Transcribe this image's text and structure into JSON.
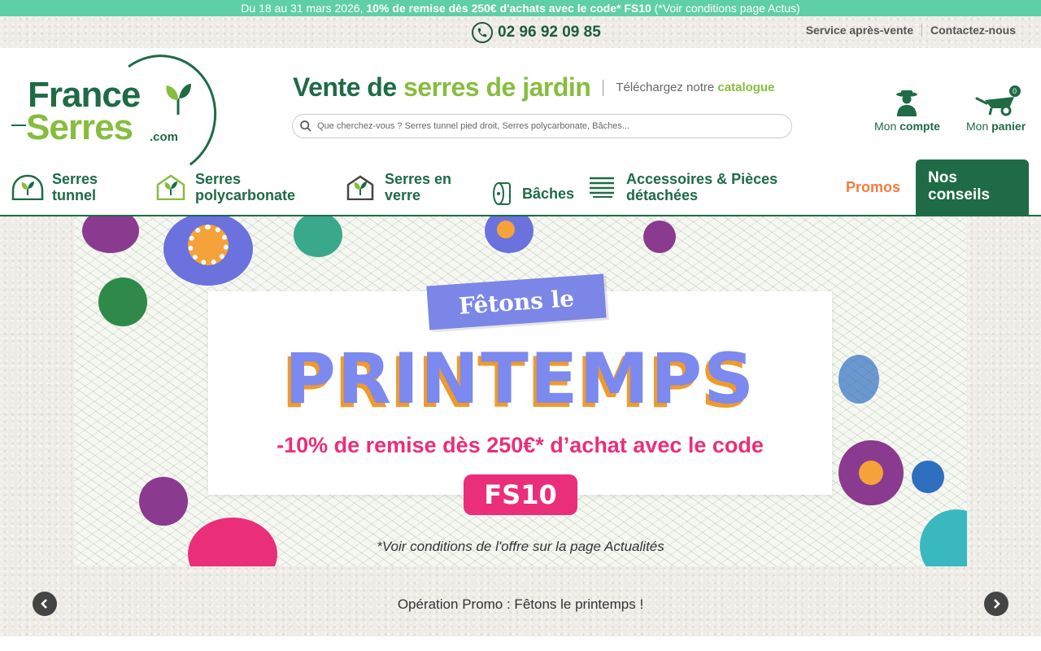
{
  "promo_bar": {
    "prefix": "Du 18 au 31 mars 2026, ",
    "bold": "10% de remise dès 250€ d'achats avec le code* FS10",
    "suffix": " (*Voir conditions page Actus)"
  },
  "utility": {
    "phone": "02 96 92 09 85",
    "links": [
      "Service après-vente",
      "Contactez-nous"
    ]
  },
  "logo": {
    "line1": "France",
    "line2": "Serres",
    "line3": ".com"
  },
  "tagline": {
    "part1": "Vente de ",
    "part2": "serres de jardin",
    "catalog_prefix": "Téléchargez notre ",
    "catalog_link": "catalogue"
  },
  "search": {
    "placeholder": "Que cherchez-vous ? Serres tunnel pied droit, Serres polycarbonate, Bâches..."
  },
  "account": {
    "prefix": "Mon ",
    "bold": "compte"
  },
  "cart": {
    "prefix": "Mon ",
    "bold": "panier",
    "count": "0"
  },
  "nav": {
    "items": [
      {
        "line1": "Serres",
        "line2": "tunnel"
      },
      {
        "line1": "Serres",
        "line2": "polycarbonate"
      },
      {
        "line1": "Serres en",
        "line2": "verre"
      },
      {
        "line1": "Bâches",
        "line2": ""
      },
      {
        "line1": "Accessoires & Pièces",
        "line2": "détachées"
      }
    ],
    "promos": "Promos",
    "conseils_line1": "Nos",
    "conseils_line2": "conseils"
  },
  "banner": {
    "ribbon": "Fêtons le",
    "headline": "PRINTEMPS",
    "subline": "-10% de remise dès 250€* d’achat avec le code",
    "code": "FS10",
    "conditions": "*Voir conditions de l'offre sur la page Actualités"
  },
  "carousel": {
    "caption": "Opération Promo : Fêtons le printemps !"
  },
  "colors": {
    "brand_green": "#1e6b45",
    "accent_green": "#86bd3e",
    "promo_teal": "#5fcfa6",
    "promo_orange": "#f07c3e",
    "banner_purple": "#7c89ee",
    "banner_pink": "#ea2e7a"
  }
}
